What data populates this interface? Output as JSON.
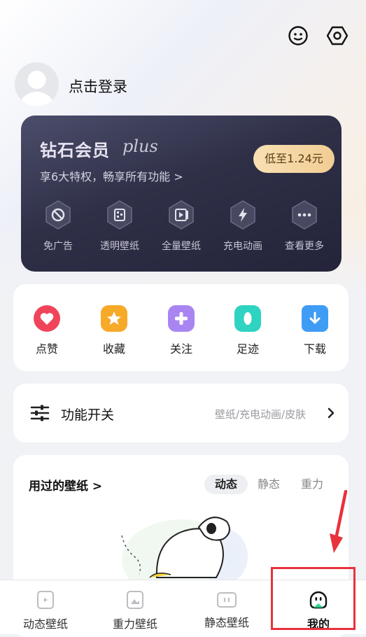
{
  "header": {
    "login_text": "点击登录"
  },
  "vip": {
    "title": "钻石会员",
    "plus": "plus",
    "subtitle": "享6大特权，畅享所有功能 >",
    "price": "低至1.24元",
    "features": [
      {
        "label": "免广告",
        "icon": "no-ads-icon"
      },
      {
        "label": "透明壁纸",
        "icon": "transparent-wallpaper-icon"
      },
      {
        "label": "全量壁纸",
        "icon": "all-wallpaper-icon"
      },
      {
        "label": "充电动画",
        "icon": "charging-icon"
      },
      {
        "label": "查看更多",
        "icon": "more-icon"
      }
    ]
  },
  "quick": [
    {
      "label": "点赞",
      "icon": "heart-icon",
      "color": "#f0445a"
    },
    {
      "label": "收藏",
      "icon": "star-icon",
      "color": "#f7a928"
    },
    {
      "label": "关注",
      "icon": "plus-icon",
      "color": "#a985f2"
    },
    {
      "label": "足迹",
      "icon": "footprint-icon",
      "color": "#2fd3c2"
    },
    {
      "label": "下载",
      "icon": "download-folder-icon",
      "color": "#3f9cf5"
    }
  ],
  "switch": {
    "title": "功能开关",
    "subtitle": "壁纸/充电动画/皮肤"
  },
  "used": {
    "title": "用过的壁纸 >",
    "tabs": [
      "动态",
      "静态",
      "重力"
    ],
    "active_tab": "动态"
  },
  "nav": [
    {
      "label": "动态壁纸",
      "icon": "dynamic-wallpaper-icon"
    },
    {
      "label": "重力壁纸",
      "icon": "gravity-wallpaper-icon"
    },
    {
      "label": "静态壁纸",
      "icon": "static-wallpaper-icon"
    },
    {
      "label": "我的",
      "icon": "mine-icon",
      "active": true
    }
  ],
  "colors": {
    "highlight": "#e8323c",
    "vip_bg": "#2f3047",
    "price_bg": "#f2cd93"
  }
}
